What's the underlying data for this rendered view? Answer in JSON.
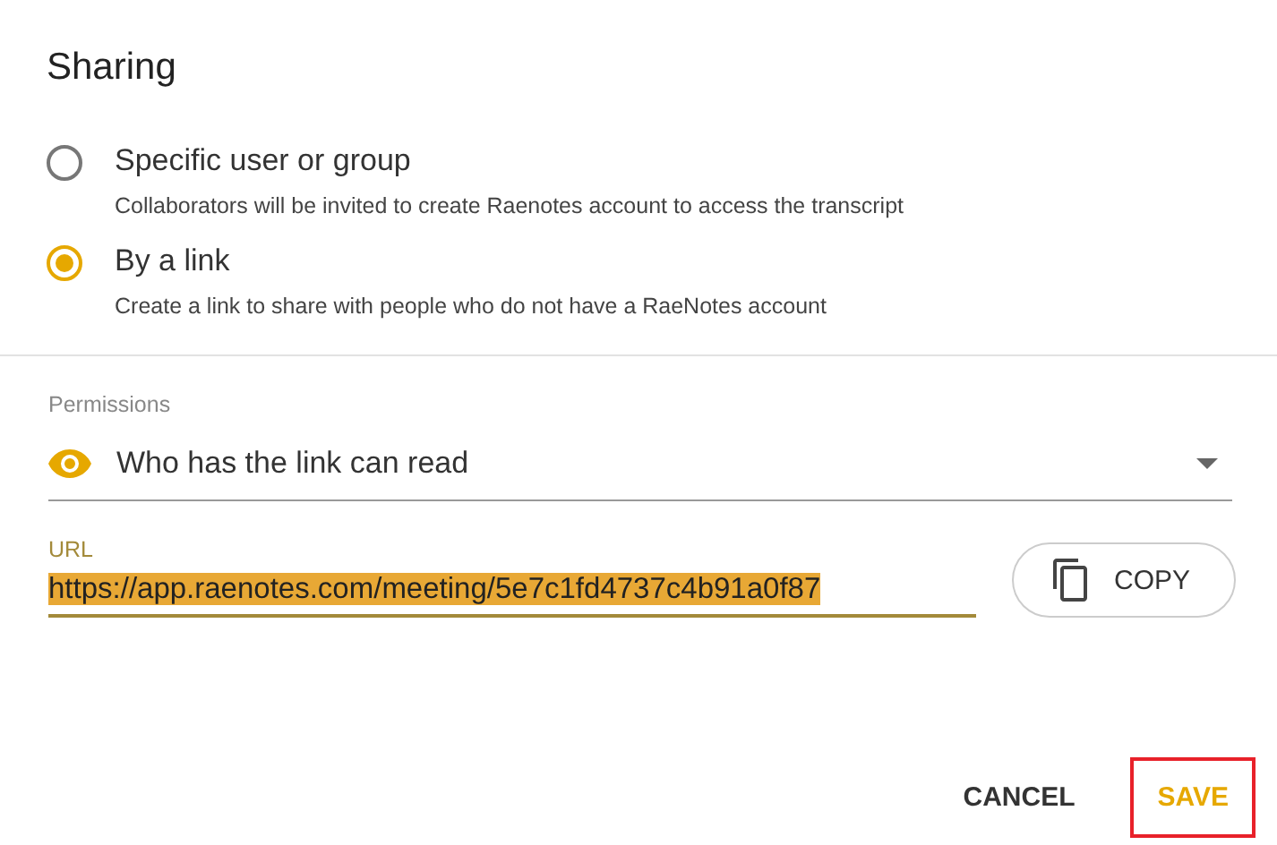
{
  "dialog": {
    "title": "Sharing"
  },
  "options": [
    {
      "label": "Specific user or group",
      "description": "Collaborators will be invited to create Raenotes account to access the transcript",
      "selected": false
    },
    {
      "label": "By a link",
      "description": "Create a link to share with people who do not have a RaeNotes account",
      "selected": true
    }
  ],
  "permissions": {
    "label": "Permissions",
    "value": "Who has the link can read"
  },
  "url": {
    "label": "URL",
    "value": "https://app.raenotes.com/meeting/5e7c1fd4737c4b91a0f87",
    "text_selected": true
  },
  "copy_button": "COPY",
  "buttons": [
    {
      "label": "CANCEL",
      "kind": "plain",
      "highlighted": false
    },
    {
      "label": "SAVE",
      "kind": "primary",
      "highlighted": true
    }
  ]
}
